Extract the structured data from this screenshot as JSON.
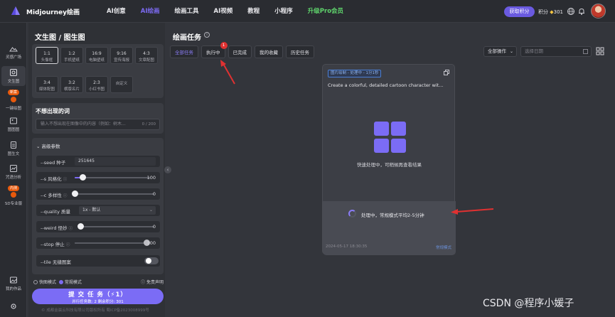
{
  "topbar": {
    "brand": "Midjourney绘画",
    "nav": [
      "AI创意",
      "AI绘画",
      "绘画工具",
      "AI视频",
      "教程",
      "小程序",
      "升级Pro会员"
    ],
    "active_nav": "AI绘画",
    "get_credits": "获取积分",
    "credits_label": "积分",
    "credits_value": "301"
  },
  "rail": {
    "items": [
      {
        "label": "灵感广场",
        "icon": "landscape-icon"
      },
      {
        "label": "文生图",
        "icon": "image-edit-icon"
      },
      {
        "label": "一键绘图",
        "icon": "magic-icon",
        "badge": "新案"
      },
      {
        "label": "图图图",
        "icon": "image-icon"
      },
      {
        "label": "图生文",
        "icon": "document-icon"
      },
      {
        "label": "咒语分析",
        "icon": "analysis-icon"
      },
      {
        "label": "SD专业版",
        "icon": "sd-icon",
        "badge": "内测"
      },
      {
        "label": "我的作品",
        "icon": "gallery-icon"
      },
      {
        "label": "",
        "icon": "settings-icon"
      }
    ]
  },
  "panel": {
    "title": "文生图 / 图生图",
    "ratios": [
      {
        "ratio": "1:1",
        "name": "头像框",
        "selected": true
      },
      {
        "ratio": "1:2",
        "name": "手机壁纸"
      },
      {
        "ratio": "16:9",
        "name": "电脑壁纸"
      },
      {
        "ratio": "9:16",
        "name": "宣传海报"
      },
      {
        "ratio": "4:3",
        "name": "文章配图"
      },
      {
        "ratio": "3:4",
        "name": "媒体配图"
      },
      {
        "ratio": "3:2",
        "name": "横版名片"
      },
      {
        "ratio": "2:3",
        "name": "小红书图"
      },
      {
        "ratio": "",
        "name": "自定义"
      }
    ],
    "negative": {
      "title": "不想出现的词",
      "placeholder": "输入不想出现在图像中的内容（例如：树木...",
      "count": "0 / 200"
    },
    "advanced": {
      "title": "高级参数",
      "seed_label": "--seed 种子",
      "seed_value": "251645",
      "stylize_label": "--s 风格化",
      "stylize_value": "100",
      "chaos_label": "--c 多样性",
      "chaos_value": "0",
      "quality_label": "--quality 质量",
      "quality_value": "1x - 默认",
      "weird_label": "--weird 怪妙",
      "weird_value": "0",
      "stop_label": "--stop 停止",
      "stop_value": "100",
      "tile_label": "--tile 无缝图案"
    },
    "mode": {
      "fast": "快图模式",
      "normal": "常规模式",
      "disclaimer": "免责声明"
    },
    "submit": {
      "label": "提 交 任 务（⚡1）",
      "sub": "并行任务数: 2  剩余积分: 301"
    },
    "footer": "© 成都金晨云科技有限公司版权所有 蜀ICP备2023008999号"
  },
  "main": {
    "title": "绘画任务",
    "tabs": [
      {
        "label": "全部任务",
        "active": true
      },
      {
        "label": "执行中",
        "badge": "1"
      },
      {
        "label": "已完成"
      },
      {
        "label": "我的收藏"
      },
      {
        "label": "历史任务"
      }
    ],
    "all_ops": "全部操作",
    "date_placeholder": "选择日期",
    "card": {
      "status": "图片绘制 - 处理中 - 1分1秒",
      "prompt": "Create a colorful, detailed cartoon character wit...",
      "quick_note": "快速处理中，可稍候再查看结果",
      "processing": "处理中，常规模式平均2-5分钟",
      "time": "2024-05-17 18:30:35",
      "mode": "常规模式"
    }
  },
  "slider_levels": {
    "stylize": 0.1,
    "chaos": 0.0,
    "weird": 0.0,
    "stop": 1.0
  },
  "watermark": "CSDN @程序小媛子",
  "colors": {
    "accent": "#7b6cf5",
    "pro_green": "#5fd36c",
    "annotation_red": "#e03131"
  }
}
